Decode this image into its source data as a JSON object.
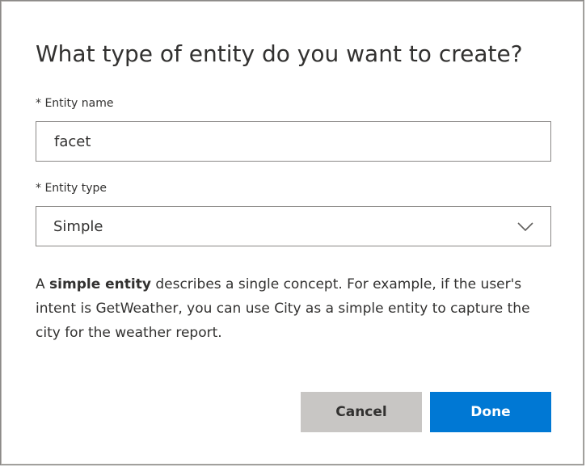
{
  "dialog": {
    "title": "What type of entity do you want to create?",
    "entity_name": {
      "label": "* Entity name",
      "value": "facet"
    },
    "entity_type": {
      "label": "* Entity type",
      "selected": "Simple"
    },
    "description": {
      "prefix": "A ",
      "emphasis": "simple entity",
      "suffix": " describes a single concept. For example, if the user's intent is GetWeather, you can use City as a simple entity to capture the city for the weather report."
    },
    "buttons": {
      "cancel": "Cancel",
      "done": "Done"
    }
  },
  "icons": {
    "dropdown": "chevron-down-icon"
  },
  "colors": {
    "primary": "#0078d4",
    "secondary_button": "#c8c6c4",
    "border": "#8a8886",
    "text": "#323130"
  }
}
